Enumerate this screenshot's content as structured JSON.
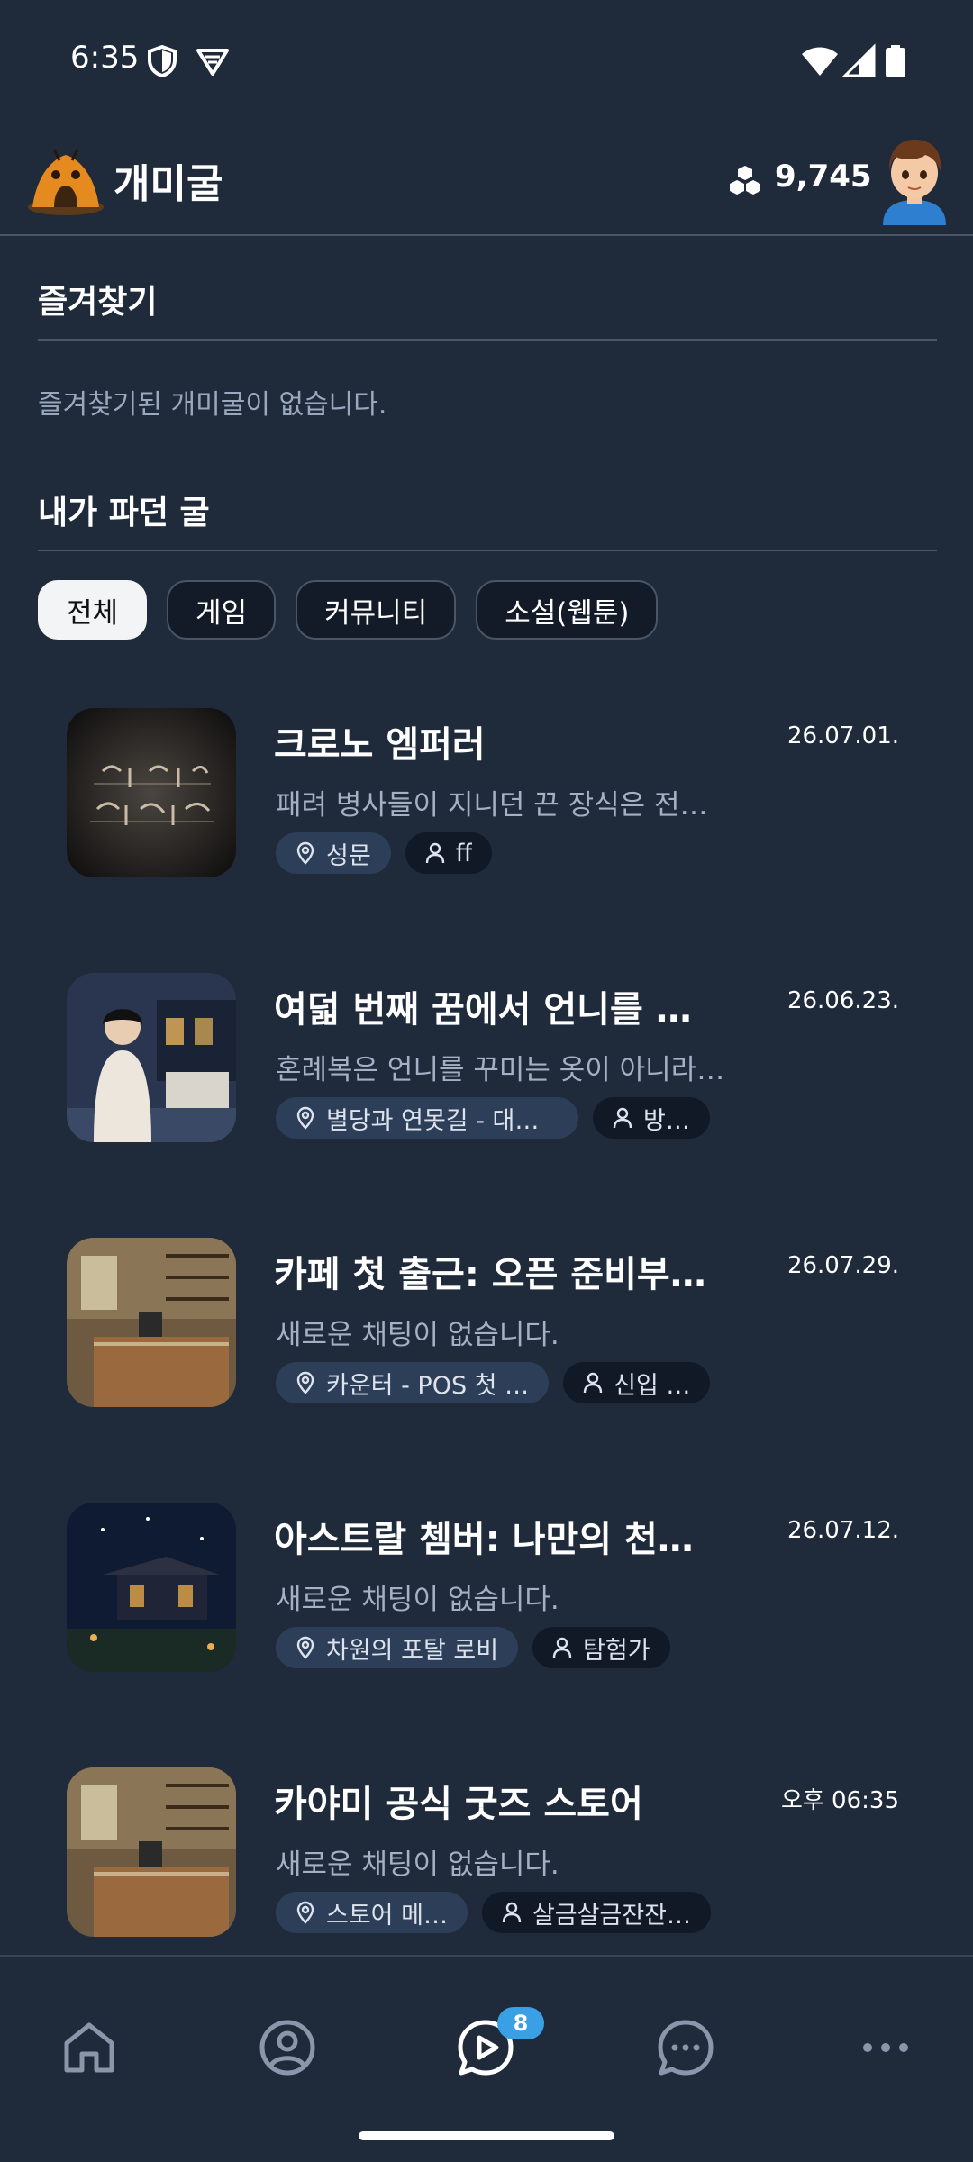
{
  "status_bar": {
    "time": "6:35",
    "icons": [
      "shield-icon",
      "vpn-icon",
      "wifi-icon",
      "signal-icon",
      "battery-icon"
    ]
  },
  "header": {
    "app_title": "개미굴",
    "coin_count": "9,745",
    "logo_icon": "ant-hill-logo",
    "coin_icon": "hexagon-coins-icon"
  },
  "favorites": {
    "title": "즐겨찾기",
    "empty_text": "즐겨찾기된 개미굴이 없습니다."
  },
  "my_rooms": {
    "title": "내가 파던 굴",
    "filters": [
      {
        "label": "전체",
        "active": true
      },
      {
        "label": "게임",
        "active": false
      },
      {
        "label": "커뮤니티",
        "active": false
      },
      {
        "label": "소설(웹툰)",
        "active": false
      }
    ],
    "rooms": [
      {
        "title": "크로노 엠퍼러",
        "date": "26.07.01.",
        "preview": "패려 병사들이 지니던 끈 장식은 전…",
        "location": "성문",
        "user": "ff"
      },
      {
        "title": "여덟 번째 꿈에서 언니를 …",
        "date": "26.06.23.",
        "preview": "혼례복은 언니를 꾸미는 옷이 아니라…",
        "location": "별당과 연못길 - 대나…",
        "user": "방…"
      },
      {
        "title": "카페 첫 출근: 오픈 준비부…",
        "date": "26.07.29.",
        "preview": "새로운 채팅이 없습니다.",
        "location": "카운터 - POS 첫 …",
        "user": "신입 …"
      },
      {
        "title": "아스트랄 쳄버: 나만의 천…",
        "date": "26.07.12.",
        "preview": "새로운 채팅이 없습니다.",
        "location": "차원의 포탈 로비",
        "user": "탐험가"
      },
      {
        "title": "카야미 공식 굿즈 스토어",
        "date": "오후 06:35",
        "preview": "새로운 채팅이 없습니다.",
        "location": "스토어 메…",
        "user": "살금살금잔잔…"
      }
    ]
  },
  "bottom_nav": {
    "items": [
      "home-icon",
      "profile-icon",
      "chat-play-icon",
      "messages-icon",
      "more-icon"
    ],
    "badge": "8"
  },
  "colors": {
    "background": "#1f2a3b",
    "badge": "#3aa0e6",
    "location_tag": "#2c3e58",
    "user_tag": "#111927"
  }
}
